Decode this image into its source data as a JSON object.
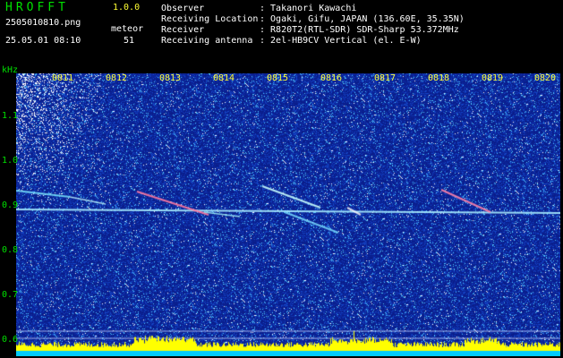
{
  "header": {
    "app_title": "HROFFT",
    "app_version": "1.0.0",
    "file_name": "2505010810.png",
    "date_time": "25.05.01 08:10",
    "meteor_label": "meteor",
    "meteor_count": "51"
  },
  "info": [
    {
      "label": "Observer",
      "value": ": Takanori Kawachi"
    },
    {
      "label": "Receiving Location",
      "value": ": Ogaki, Gifu, JAPAN (136.60E, 35.35N)"
    },
    {
      "label": "Receiver",
      "value": ": R820T2(RTL-SDR) SDR-Sharp 53.372MHz"
    },
    {
      "label": "Receiving antenna",
      "value": ": 2el-HB9CV Vertical (el. E-W)"
    }
  ],
  "chart_data": {
    "type": "heatmap",
    "ylabel": "kHz",
    "y_ticks": [
      "1.1",
      "1.0",
      "0.9",
      "0.8",
      "0.7",
      "0.6"
    ],
    "x_ticks": [
      "0811",
      "0812",
      "0813",
      "0814",
      "0815",
      "0816",
      "0817",
      "0818",
      "0819",
      "0820"
    ],
    "colors": {
      "background": "#0a1d8a",
      "signal": "#00e0ff",
      "bars": "#ffff00",
      "strip": "#00ccff"
    }
  }
}
